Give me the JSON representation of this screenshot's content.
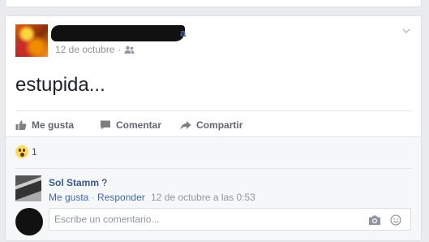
{
  "post": {
    "author_suffix": "a",
    "date": "12 de octubre",
    "separator": "·",
    "text": "estupida..."
  },
  "actions": {
    "like": "Me gusta",
    "comment": "Comentar",
    "share": "Compartir"
  },
  "reactions": {
    "count": "1"
  },
  "comment": {
    "author": "Sol Stamm",
    "text": "?",
    "like_link": "Me gusta",
    "dot": " · ",
    "reply_link": "Responder",
    "timestamp": "12 de octubre a las 0:53"
  },
  "composer": {
    "placeholder": "Escribe un comentario..."
  },
  "colors": {
    "link": "#365899",
    "meta": "#90949c",
    "background": "#e9ebee"
  }
}
